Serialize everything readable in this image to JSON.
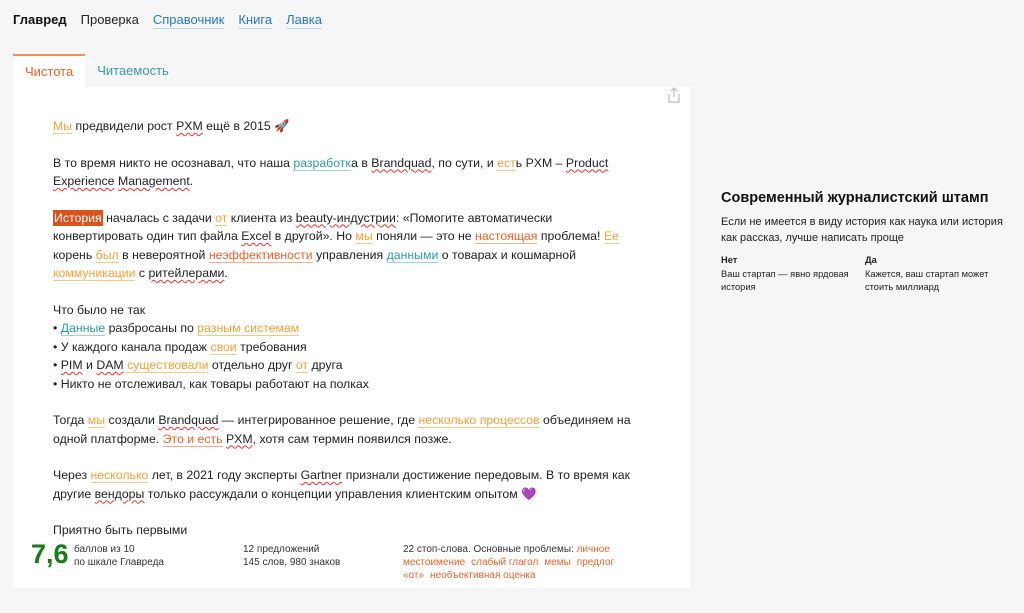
{
  "nav": {
    "items": [
      {
        "label": "Главред",
        "kind": "cur"
      },
      {
        "label": "Проверка",
        "kind": "plain"
      },
      {
        "label": "Справочник",
        "kind": "lnk"
      },
      {
        "label": "Книга",
        "kind": "lnk"
      },
      {
        "label": "Лавка",
        "kind": "lnk"
      }
    ]
  },
  "tabs": [
    {
      "label": "Чистота"
    },
    {
      "label": "Читаемость"
    }
  ],
  "share_icon": "share-icon",
  "paragraphs": [
    [
      [
        [
          "Мы",
          "o"
        ],
        [
          " предвидели рост "
        ],
        [
          "PXM",
          "r"
        ],
        [
          " ещё в 2015 🚀"
        ]
      ]
    ],
    [
      [
        [
          "В то время никто не осознавал, что наша "
        ],
        [
          "разработк",
          "t"
        ],
        [
          "а в "
        ],
        [
          "Brandquad",
          "r"
        ],
        [
          ", по сути, и "
        ],
        [
          "ест",
          "o"
        ],
        [
          "ь PXM – "
        ],
        [
          "Product",
          "r"
        ],
        [
          " "
        ],
        [
          "Experience",
          "r"
        ],
        [
          " "
        ],
        [
          "Management",
          "r"
        ],
        [
          "."
        ]
      ]
    ],
    [
      [
        [
          "История",
          "s"
        ],
        [
          " началась с задачи "
        ],
        [
          "от",
          "o"
        ],
        [
          " клиента из "
        ],
        [
          "beauty-индустрии",
          "r"
        ],
        [
          ": «Помогите автоматически конвертировать один тип файла "
        ],
        [
          "Excel",
          "r"
        ],
        [
          " в другой». Но "
        ],
        [
          "мы",
          "o"
        ],
        [
          " поняли — это не "
        ],
        [
          "настоящая",
          "d"
        ],
        [
          " проблема! "
        ],
        [
          "Ее",
          "o"
        ],
        [
          " корень "
        ],
        [
          "был",
          "o"
        ],
        [
          " в невероятной "
        ],
        [
          "неэффективности",
          "d"
        ],
        [
          " управления "
        ],
        [
          "данными",
          "t"
        ],
        [
          " о товарах и кошмарной "
        ],
        [
          "коммуникации",
          "o"
        ],
        [
          " с "
        ],
        [
          "ритейлерами",
          "r"
        ],
        [
          "."
        ]
      ]
    ],
    [
      [
        [
          "Что было не так"
        ]
      ],
      [
        [
          "• "
        ],
        [
          "Данные",
          "t"
        ],
        [
          " разбросаны по "
        ],
        [
          "разным системам",
          "o"
        ]
      ],
      [
        [
          "• У каждого канала продаж "
        ],
        [
          "свои",
          "o"
        ],
        [
          " требования"
        ]
      ],
      [
        [
          "• "
        ],
        [
          "PIM",
          "r"
        ],
        [
          " и "
        ],
        [
          "DAM",
          "r"
        ],
        [
          " "
        ],
        [
          "существовали",
          "o"
        ],
        [
          " отдельно друг "
        ],
        [
          "от",
          "o"
        ],
        [
          " друга"
        ]
      ],
      [
        [
          "• Никто не отслеживал, как товары работают на полках"
        ]
      ]
    ],
    [
      [
        [
          "Тогда "
        ],
        [
          "мы",
          "o"
        ],
        [
          " создали "
        ],
        [
          "Brandquad",
          "r"
        ],
        [
          " — интегрированное решение, где "
        ],
        [
          "несколько процессов",
          "o"
        ],
        [
          " объединяем на одной платформе. "
        ],
        [
          "Это и есть",
          "d"
        ],
        [
          " "
        ],
        [
          "PXM",
          "r"
        ],
        [
          ", хотя сам термин появился позже."
        ]
      ]
    ],
    [
      [
        [
          "Через "
        ],
        [
          "несколько",
          "o"
        ],
        [
          " лет, в 2021 году эксперты "
        ],
        [
          "Gartner",
          "r"
        ],
        [
          " признали достижение передовым. В то время как другие "
        ],
        [
          "вендоры",
          "r"
        ],
        [
          " только рассуждали о концепции управления клиентским опытом 💜"
        ]
      ]
    ],
    [
      [
        [
          "Приятно быть первыми"
        ]
      ]
    ]
  ],
  "stats": {
    "score": "7,6",
    "score_l1": "баллов из 10",
    "score_l2": "по шкале Главреда",
    "sent_l1": "12 предложений",
    "sent_l2": "145 слов, 980 знаков",
    "stop_prefix": "22 стоп-слова. Основные проблемы: ",
    "problems": [
      "личное местоимение",
      "слабый глагол",
      "мемы",
      "предлог «от»",
      "необъективная оценка"
    ]
  },
  "side": {
    "title": "Современный журналистский штамп",
    "desc": "Если не имеется в виду история как наука или история как рассказ, лучше написать проще",
    "no_label": "Нет",
    "no_text": "Ваш стартап — явно ярдовая история",
    "yes_label": "Да",
    "yes_text": "Кажется, ваш стартап может стоить миллиард"
  },
  "colors": {
    "accent": "#e8642c",
    "orange": "#f2a23a",
    "teal": "#2f9aa0",
    "score": "#1a7a1a"
  }
}
